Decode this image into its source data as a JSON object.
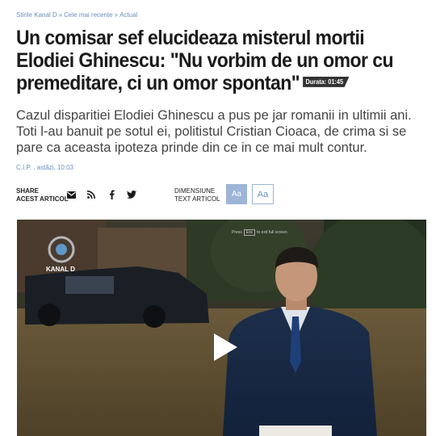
{
  "breadcrumb": [
    "Stirile Kanal D",
    "Cele mai recente",
    "Actual"
  ],
  "article": {
    "title": "Un comisar sef elucideaza misterul mortii Elodiei Ghinescu: \"Nu vorbim de un omor cu premeditare, ci un omor spontan\"",
    "duration": "Durata: 01:45",
    "lead": "Cazul disparitiei Elodiei Ghinescu a pus pe jar romanii in ultimii ani. Toti l-au banuit pe sotul ei, politistul Cristian Cioaca, de crima si se pare ca aceasta ipoteza prinde din ce in ce mai mult contur.",
    "meta": "C.I.P. , astăzi, 10:03"
  },
  "share": {
    "label_top": "SHARE",
    "label_bottom": "acest articol",
    "icons": [
      "email-icon",
      "rss-icon",
      "facebook-icon",
      "twitter-icon"
    ]
  },
  "text_size": {
    "label_top": "DIMENSIUNE",
    "label_bottom": "TEXT ARTICOL",
    "small": "Aa",
    "large": "Aa"
  },
  "video": {
    "channel_logo": "KANAL D",
    "esc_hint_pre": "Press",
    "esc_key": "Esc",
    "esc_hint_post": "to exit full screen"
  },
  "colors": {
    "link": "#6a8fbf",
    "accent": "#9db5d6"
  }
}
